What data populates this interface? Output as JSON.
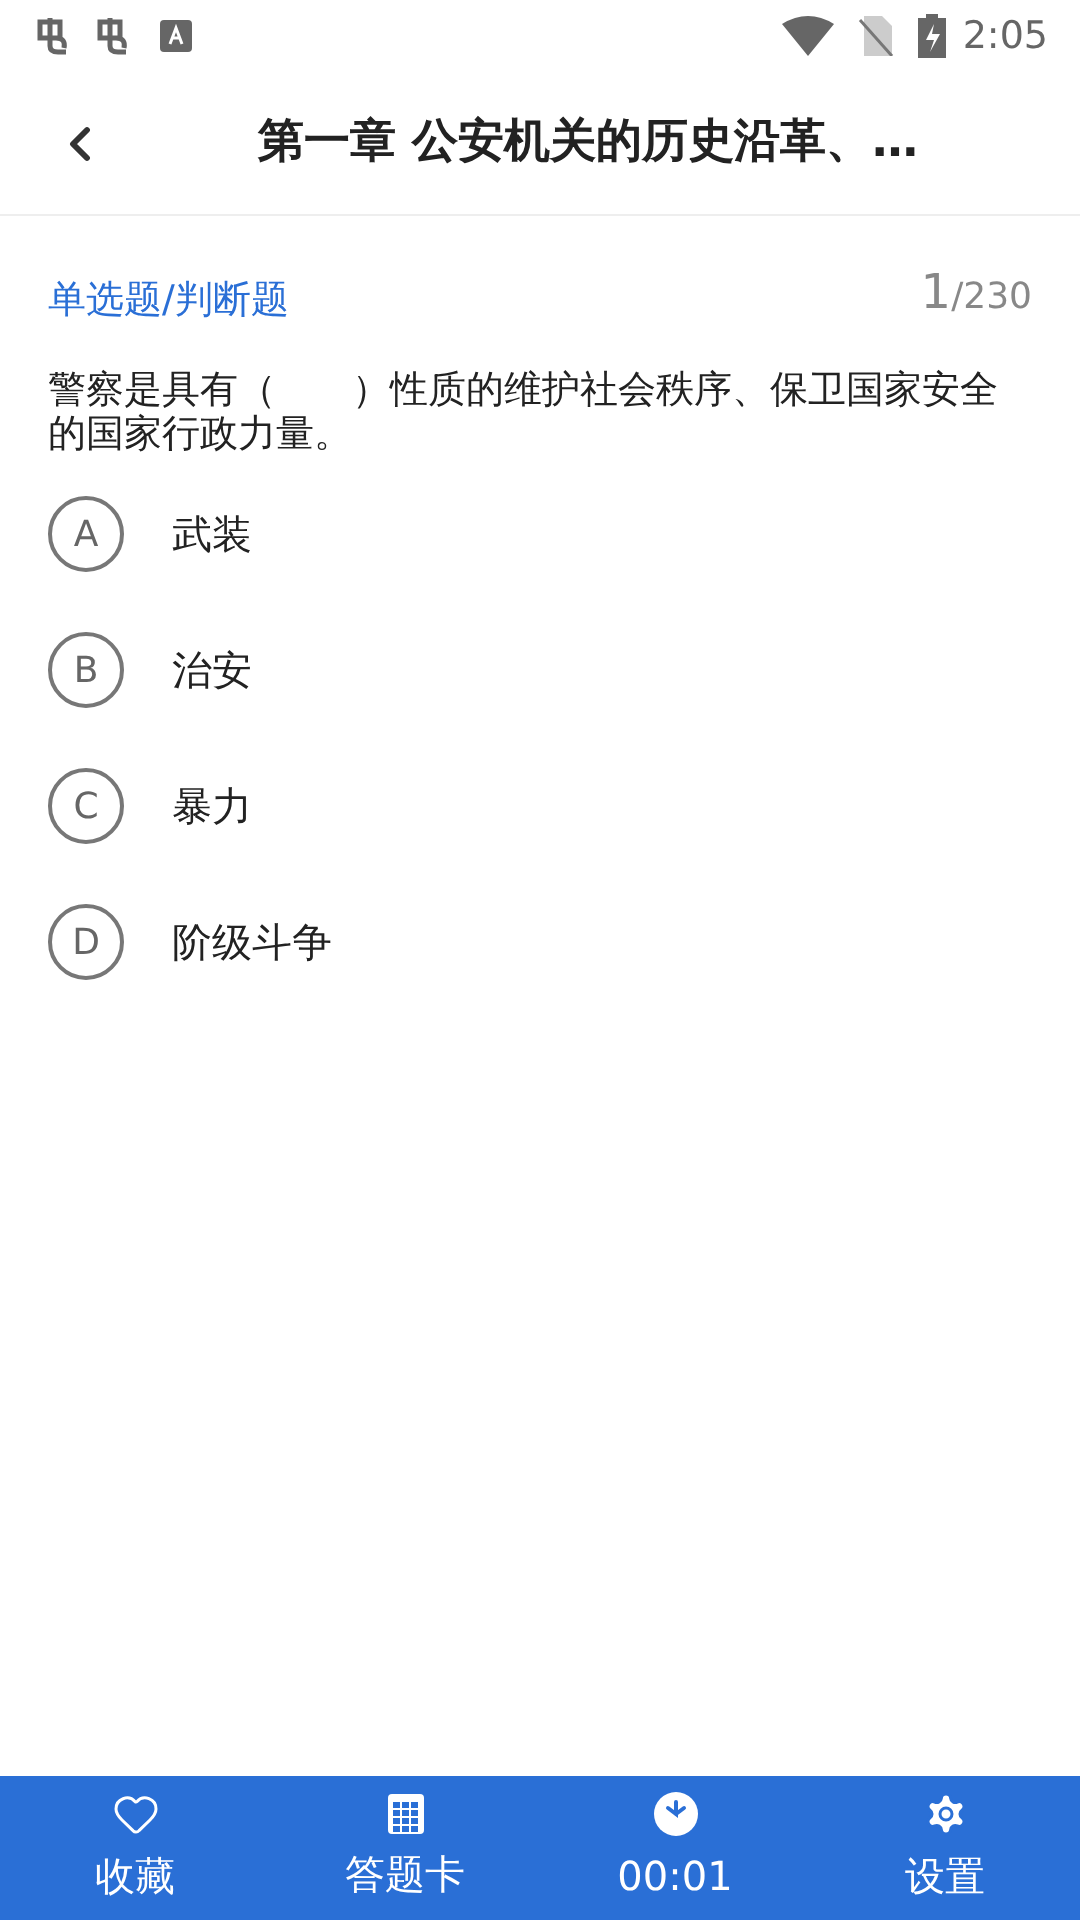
{
  "status_bar": {
    "time": "2:05"
  },
  "header": {
    "title": "第一章 公安机关的历史沿革、…"
  },
  "question": {
    "type": "单选题/判断题",
    "current": "1",
    "total": "/230",
    "text": "警察是具有（　　）性质的维护社会秩序、保卫国家安全的国家行政力量。",
    "options": [
      {
        "letter": "A",
        "text": "武装"
      },
      {
        "letter": "B",
        "text": "治安"
      },
      {
        "letter": "C",
        "text": "暴力"
      },
      {
        "letter": "D",
        "text": "阶级斗争"
      }
    ]
  },
  "bottom_bar": [
    {
      "kind": "favorite",
      "label": "收藏"
    },
    {
      "kind": "card",
      "label": "答题卡"
    },
    {
      "kind": "timer",
      "label": "00:01"
    },
    {
      "kind": "settings",
      "label": "设置"
    }
  ]
}
